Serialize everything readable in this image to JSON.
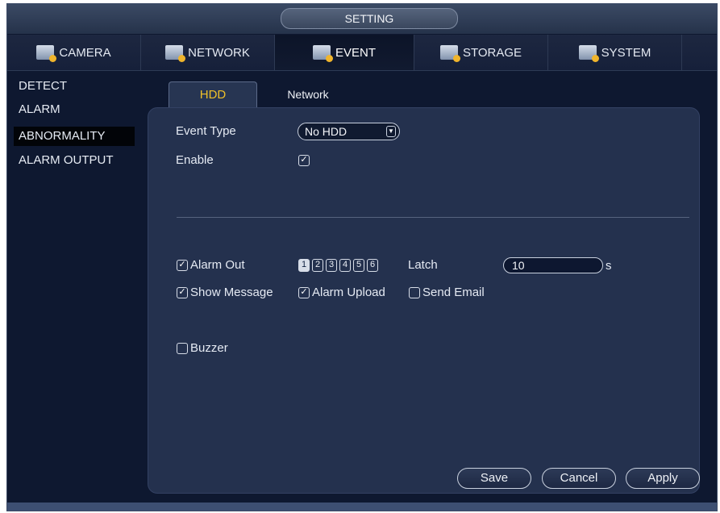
{
  "window": {
    "title": "SETTING"
  },
  "topnav": [
    {
      "label": "CAMERA",
      "icon": "camera-icon"
    },
    {
      "label": "NETWORK",
      "icon": "network-icon"
    },
    {
      "label": "EVENT",
      "icon": "event-icon"
    },
    {
      "label": "STORAGE",
      "icon": "storage-icon"
    },
    {
      "label": "SYSTEM",
      "icon": "system-icon"
    }
  ],
  "sidebar": {
    "items": [
      {
        "label": "DETECT"
      },
      {
        "label": "ALARM"
      },
      {
        "label": "ABNORMALITY"
      },
      {
        "label": "ALARM OUTPUT"
      }
    ]
  },
  "tabs": [
    {
      "label": "HDD"
    },
    {
      "label": "Network"
    }
  ],
  "form": {
    "event_type_label": "Event Type",
    "event_type_value": "No HDD",
    "enable_label": "Enable",
    "enable_checked": true,
    "alarm_out_label": "Alarm Out",
    "alarm_out_checked": true,
    "alarm_channels": [
      "1",
      "2",
      "3",
      "4",
      "5",
      "6"
    ],
    "alarm_channels_selected": [
      "1"
    ],
    "latch_label": "Latch",
    "latch_value": "10",
    "latch_unit": "s",
    "show_message_label": "Show Message",
    "show_message_checked": true,
    "alarm_upload_label": "Alarm Upload",
    "alarm_upload_checked": true,
    "send_email_label": "Send Email",
    "send_email_checked": false,
    "buzzer_label": "Buzzer",
    "buzzer_checked": false
  },
  "buttons": {
    "save": "Save",
    "cancel": "Cancel",
    "apply": "Apply"
  },
  "colors": {
    "active_tab_text": "#f0c029",
    "panel_bg": "#24314e",
    "frame_bg": "#0e1830"
  }
}
